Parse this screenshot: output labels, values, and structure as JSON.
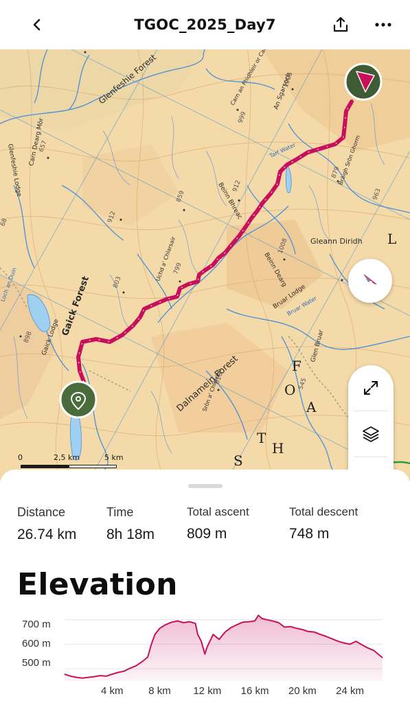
{
  "header": {
    "title": "TGOC_2025_Day7",
    "back_icon": "chevron-left-icon",
    "share_icon": "share-icon",
    "more_icon": "more-horizontal-icon"
  },
  "map": {
    "labels": {
      "forest_glenfeshie": "Glenfeshie Forest",
      "forest_gaick": "Gaick Forest",
      "forest_dalnamein": "Dalnamein Forest",
      "gleann_diridh": "Gleann Diridh",
      "gaick_lodge": "Gaick Lodge",
      "bruar_lodge": "Bruar Lodge",
      "glenfeshie_lodge": "Glenfeshie Lodge",
      "loch_an_duin": "Loch an Duin",
      "beinn_bhreac": "Beinn Bhreac",
      "beinn_dearg": "Beinn Dearg",
      "carn_dearg_mor": "Carn Dearg Mòr",
      "an_sgarsoch": "An Sgarsoch",
      "carn_ealar": "Carn an Fhidhleir or Carn Ealar",
      "braigh_sron": "Bràigh Sròn Ghorm",
      "uchd": "Uchd a' Chlarsair",
      "sron_chlamhaine": "Sròn a' Chleirich",
      "big_letters_s": "S",
      "big_letters_t": "T",
      "big_letters_o": "O",
      "big_letters_h": "H",
      "big_letters_a": "A",
      "big_letters_l": "L",
      "big_letters_f": "F",
      "glen_bruar": "Glen Bruar",
      "tarf_water": "Tarf Water",
      "bruar_water": "Bruar Water",
      "spot_657": "657",
      "spot_912a": "912",
      "spot_912b": "912",
      "spot_859": "859",
      "spot_799": "799",
      "spot_803": "803",
      "spot_898": "898",
      "spot_816": "816",
      "spot_1008": "1008",
      "spot_999": "999",
      "spot_1006": "1006",
      "spot_879": "879",
      "spot_963": "963",
      "spot_545": "545",
      "spot_68": "68"
    },
    "scale": {
      "left": "0",
      "mid": "2,5 km",
      "right": "5 km"
    },
    "attribution": "mapbox",
    "colors": {
      "route": "#c8105a",
      "route_start": "#4a6b3a",
      "end_marker": "#3f5b34",
      "compass_needle": "#c8105a"
    },
    "controls": {
      "compass": "compass-icon",
      "fullscreen": "expand-icon",
      "layers": "layers-icon",
      "locate": "navigation-arrow-icon"
    }
  },
  "stats": {
    "distance": {
      "label": "Distance",
      "value": "26.74 km"
    },
    "time": {
      "label": "Time",
      "value": "8h 18m"
    },
    "ascent": {
      "label": "Total ascent",
      "value": "809 m"
    },
    "descent": {
      "label": "Total descent",
      "value": "748 m"
    }
  },
  "elevation": {
    "title": "Elevation"
  },
  "chart_data": {
    "type": "area",
    "title": "Elevation",
    "xlabel": "",
    "ylabel": "",
    "x_ticks": [
      "4 km",
      "8 km",
      "12 km",
      "16 km",
      "20 km",
      "24 km"
    ],
    "y_ticks": [
      "700 m",
      "600 m",
      "500 m"
    ],
    "xlim": [
      0,
      26.74
    ],
    "ylim": [
      450,
      730
    ],
    "grid": true,
    "color": "#c8105a",
    "x": [
      0,
      0.5,
      1,
      1.5,
      2,
      2.5,
      3,
      3.5,
      4,
      4.5,
      5,
      5.5,
      6,
      6.5,
      7,
      7.3,
      7.6,
      8,
      8.5,
      9,
      9.5,
      10,
      10.5,
      11,
      11.2,
      11.5,
      11.8,
      12,
      12.5,
      13,
      13.5,
      14,
      14.5,
      15,
      15.5,
      16,
      16.3,
      16.6,
      17,
      17.5,
      18,
      18.5,
      19,
      19.5,
      20,
      20.5,
      21,
      21.5,
      22,
      22.5,
      23,
      23.5,
      24,
      24.5,
      25,
      25.5,
      26,
      26.74
    ],
    "y": [
      478,
      470,
      465,
      462,
      465,
      468,
      472,
      470,
      478,
      485,
      490,
      502,
      512,
      528,
      548,
      600,
      640,
      665,
      680,
      690,
      695,
      688,
      692,
      685,
      640,
      612,
      560,
      590,
      640,
      620,
      650,
      668,
      680,
      690,
      692,
      695,
      718,
      705,
      700,
      695,
      688,
      670,
      672,
      665,
      660,
      652,
      650,
      640,
      632,
      622,
      612,
      605,
      600,
      612,
      598,
      585,
      575,
      545
    ]
  }
}
